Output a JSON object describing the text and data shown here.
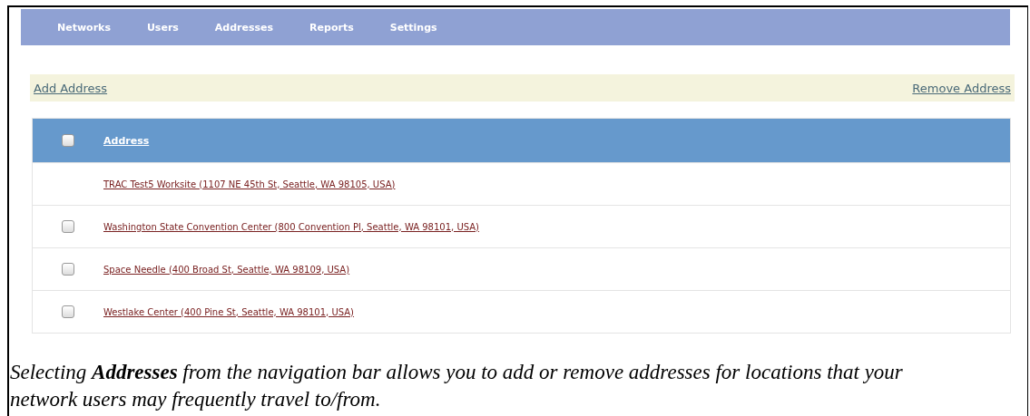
{
  "nav": [
    {
      "label": "Networks"
    },
    {
      "label": "Users"
    },
    {
      "label": "Addresses"
    },
    {
      "label": "Reports"
    },
    {
      "label": "Settings"
    }
  ],
  "actions": {
    "add": "Add Address",
    "remove": "Remove Address"
  },
  "table": {
    "header_checked": false,
    "columns": [
      "Address"
    ],
    "rows": [
      {
        "has_checkbox": false,
        "address": "TRAC Test5 Worksite (1107 NE 45th St, Seattle, WA 98105, USA)"
      },
      {
        "has_checkbox": true,
        "checked": false,
        "address": "Washington State Convention Center (800 Convention Pl, Seattle, WA 98101, USA)"
      },
      {
        "has_checkbox": true,
        "checked": false,
        "address": "Space Needle (400 Broad St, Seattle, WA 98109, USA)"
      },
      {
        "has_checkbox": true,
        "checked": false,
        "address": "Westlake Center (400 Pine St, Seattle, WA 98101, USA)"
      }
    ]
  },
  "caption": "Selecting **Addresses** from the navigation bar allows you to add or remove addresses for locations that your network users may frequently travel to/from."
}
